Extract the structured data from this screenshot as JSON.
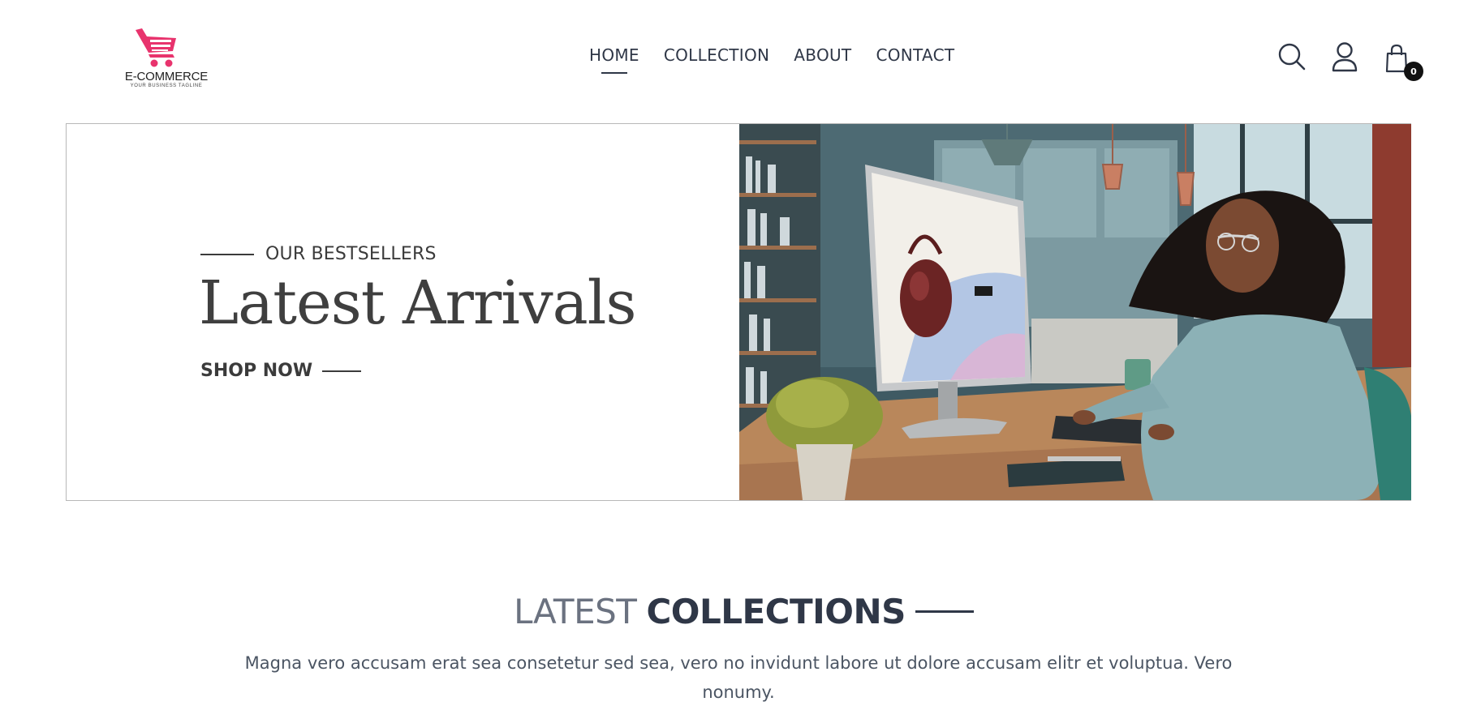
{
  "logo": {
    "title": "E-COMMERCE",
    "tagline": "YOUR BUSINESS TAGLINE",
    "icon": "shopping-cart-logo",
    "color": "#e8336d"
  },
  "nav": {
    "items": [
      {
        "label": "HOME",
        "active": true
      },
      {
        "label": "COLLECTION",
        "active": false
      },
      {
        "label": "ABOUT",
        "active": false
      },
      {
        "label": "CONTACT",
        "active": false
      }
    ]
  },
  "header_icons": {
    "search": "search-icon",
    "account": "user-icon",
    "cart": "shopping-bag-icon",
    "cart_count": "0"
  },
  "hero": {
    "eyebrow": "OUR BESTSELLERS",
    "title": "Latest Arrivals",
    "cta": "SHOP NOW",
    "image": "woman-shopping-online-at-desk-photo"
  },
  "collections": {
    "title_light": "LATEST",
    "title_bold": "COLLECTIONS",
    "description": "Magna vero accusam erat sea consetetur sed sea, vero no invidunt labore ut dolore accusam elitr et voluptua. Vero nonumy."
  }
}
